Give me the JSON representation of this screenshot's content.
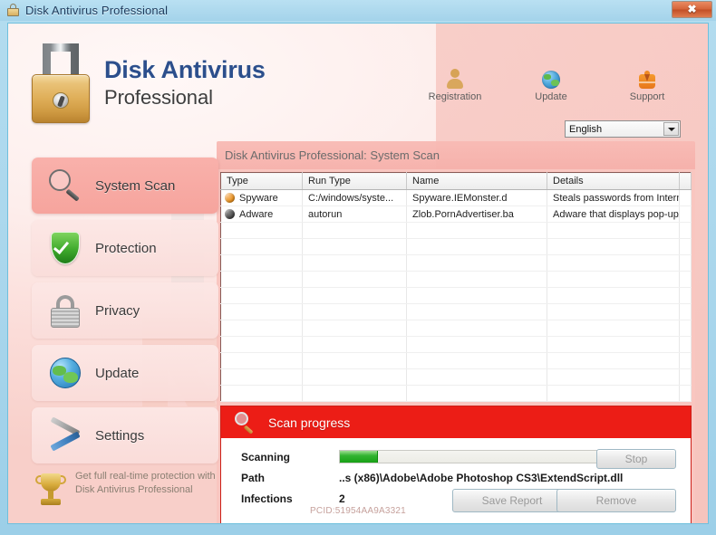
{
  "window": {
    "title": "Disk Antivirus Professional",
    "lock_icon": "lock-icon",
    "close_label": "✖"
  },
  "brand": {
    "logo_icon": "padlock-logo-icon",
    "name_line1": "Disk Antivirus",
    "name_line2": "Professional"
  },
  "header": {
    "actions": [
      {
        "label": "Registration",
        "icon": "person-icon"
      },
      {
        "label": "Update",
        "icon": "globe-icon"
      },
      {
        "label": "Support",
        "icon": "support-vest-icon"
      }
    ],
    "language": {
      "selected": "English",
      "options": [
        "English"
      ]
    }
  },
  "sidebar": {
    "items": [
      {
        "label": "System Scan",
        "icon": "magnifier-icon",
        "active": true
      },
      {
        "label": "Protection",
        "icon": "shield-check-icon",
        "active": false
      },
      {
        "label": "Privacy",
        "icon": "padlock-icon",
        "active": false
      },
      {
        "label": "Update",
        "icon": "globe-icon",
        "active": false
      },
      {
        "label": "Settings",
        "icon": "tools-icon",
        "active": false
      }
    ],
    "promo": {
      "icon": "trophy-icon",
      "text": "Get full real-time protection with Disk Antivirus Professional"
    }
  },
  "main": {
    "panel_title": "Disk Antivirus Professional: System Scan",
    "table": {
      "columns": [
        "Type",
        "Run Type",
        "Name",
        "Details",
        ""
      ],
      "rows": [
        {
          "type": "Spyware",
          "type_marker": "spyware",
          "run_type": "C:/windows/syste...",
          "name": "Spyware.IEMonster.d",
          "details": "Steals passwords from Interne...",
          "extra": ""
        },
        {
          "type": "Adware",
          "type_marker": "adware",
          "run_type": "autorun",
          "name": "Zlob.PornAdvertiser.ba",
          "details": "Adware that displays pop-up/p...",
          "extra": ""
        }
      ],
      "empty_rows": 11
    },
    "progress": {
      "header_icon": "magnifier-icon",
      "header_title": "Scan progress",
      "scanning_label": "Scanning",
      "progress_percent": 14,
      "path_label": "Path",
      "path_value": "..s (x86)\\Adobe\\Adobe Photoshop CS3\\ExtendScript.dll",
      "infections_label": "Infections",
      "infections_value": "2",
      "stop_label": "Stop",
      "save_report_label": "Save Report",
      "remove_label": "Remove"
    }
  },
  "footer": {
    "pcid": "PCID:51954AA9A3321"
  },
  "colors": {
    "accent_red": "#ec1d16",
    "brand_blue": "#2c4f8c",
    "progress_green": "#17a015",
    "panel_pink": "#f9c6c0",
    "titlebar_blue": "#a9d6ec"
  }
}
